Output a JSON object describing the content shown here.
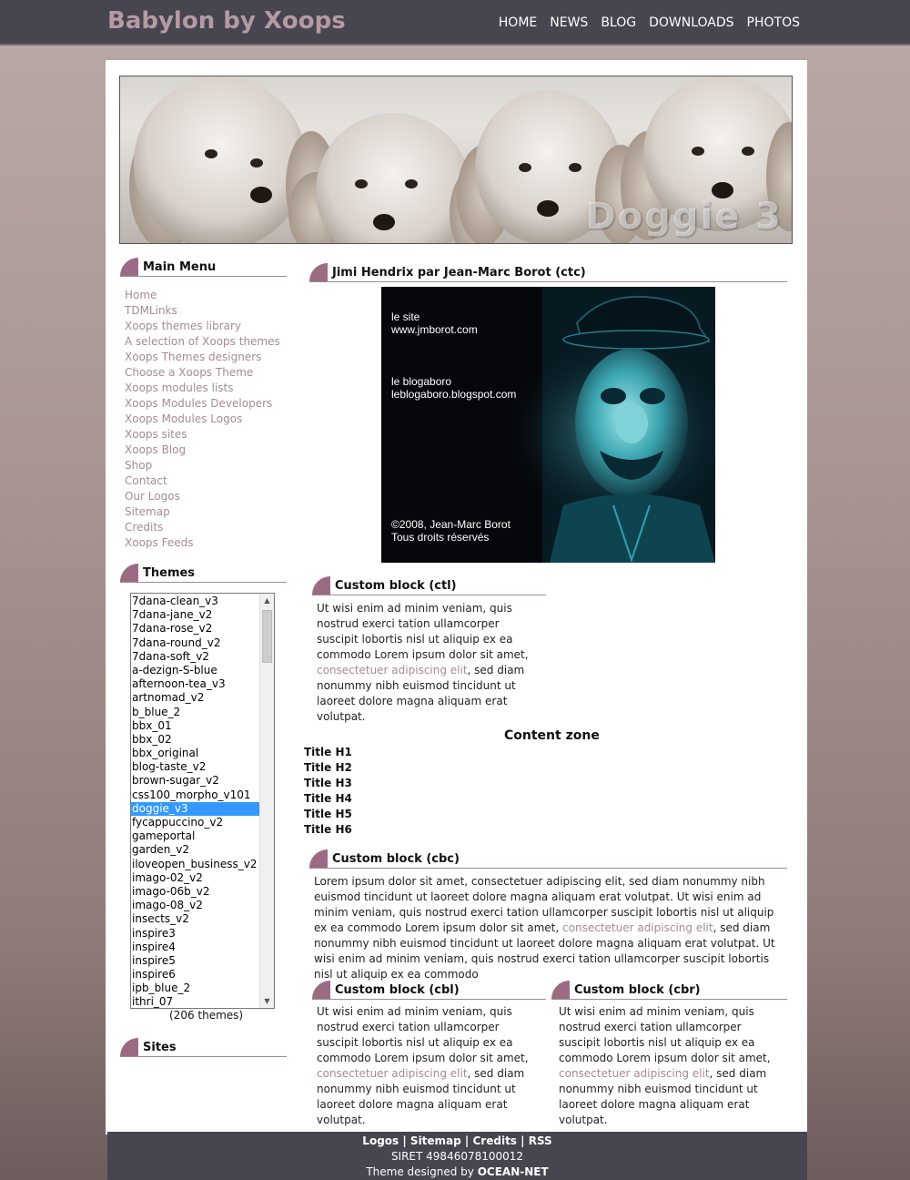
{
  "site": {
    "title": "Babylon by Xoops",
    "nav": [
      "HOME",
      "NEWS",
      "BLOG",
      "DOWNLOADS",
      "PHOTOS"
    ]
  },
  "banner": {
    "text": "Doggie 3"
  },
  "main_menu": {
    "title": "Main Menu",
    "items": [
      "Home",
      "TDMLinks",
      "Xoops themes library",
      "A selection of Xoops themes",
      "Xoops Themes designers",
      "Choose a Xoops Theme",
      "Xoops modules lists",
      "Xoops Modules Developers",
      "Xoops Modules Logos",
      "Xoops sites",
      "Xoops Blog",
      "Shop",
      "Contact",
      "Our Logos",
      "Sitemap",
      "Credits",
      "Xoops Feeds"
    ]
  },
  "themes": {
    "title": "Themes",
    "items": [
      "7dana-clean_v3",
      "7dana-jane_v2",
      "7dana-rose_v2",
      "7dana-round_v2",
      "7dana-soft_v2",
      "a-dezign-S-blue",
      "afternoon-tea_v3",
      "artnomad_v2",
      "b_blue_2",
      "bbx_01",
      "bbx_02",
      "bbx_original",
      "blog-taste_v2",
      "brown-sugar_v2",
      "css100_morpho_v101",
      "doggie_v3",
      "fycappuccino_v2",
      "gameportal",
      "garden_v2",
      "iloveopen_business_v2",
      "imago-02_v2",
      "imago-06b_v2",
      "imago-08_v2",
      "insects_v2",
      "inspire3",
      "inspire4",
      "inspire5",
      "inspire6",
      "ipb_blue_2",
      "ithri_07"
    ],
    "selected": "doggie_v3",
    "count": "(206 themes)"
  },
  "sites": {
    "title": "Sites"
  },
  "content": {
    "ctc_title": "Jimi Hendrix par Jean-Marc Borot (ctc)",
    "image_text": {
      "site_label": "le site",
      "site_url": "www.jmborot.com",
      "blog_label": "le blogaboro",
      "blog_url": "leblogaboro.blogspot.com",
      "copyright": "©2008, Jean-Marc Borot",
      "rights": "Tous droits réservés"
    },
    "ctl": {
      "title": "Custom block (ctl)",
      "text_before": "Ut wisi enim ad minim veniam, quis nostrud exerci tation ullamcorper suscipit lobortis nisl ut aliquip ex ea commodo Lorem ipsum dolor sit amet,",
      "link": "consectetuer adipiscing elit",
      "text_after": ", sed diam nonummy nibh euismod tincidunt ut laoreet dolore magna aliquam erat volutpat."
    },
    "content_zone": "Content zone",
    "headings": [
      "Title H1",
      "Title H2",
      "Title H3",
      "Title H4",
      "Title H5",
      "Title H6"
    ],
    "cbc": {
      "title": "Custom block (cbc)",
      "text_before": "Lorem ipsum dolor sit amet, consectetuer adipiscing elit, sed diam nonummy nibh euismod tincidunt ut laoreet dolore magna aliquam erat volutpat. Ut wisi enim ad minim veniam, quis nostrud exerci tation ullamcorper suscipit lobortis nisl ut aliquip ex ea commodo Lorem ipsum dolor sit amet,",
      "link": "consectetuer adipiscing elit",
      "text_after": ", sed diam nonummy nibh euismod tincidunt ut laoreet dolore magna aliquam erat volutpat. Ut wisi enim ad minim veniam, quis nostrud exerci tation ullamcorper suscipit lobortis nisl ut aliquip ex ea commodo"
    },
    "cbl": {
      "title": "Custom block (cbl)",
      "text_before": "Ut wisi enim ad minim veniam, quis nostrud exerci tation ullamcorper suscipit lobortis nisl ut aliquip ex ea commodo Lorem ipsum dolor sit amet,",
      "link": "consectetuer adipiscing elit",
      "text_after": ", sed diam nonummy nibh euismod tincidunt ut laoreet dolore magna aliquam erat volutpat."
    },
    "cbr": {
      "title": "Custom block (cbr)",
      "text_before": "Ut wisi enim ad minim veniam, quis nostrud exerci tation ullamcorper suscipit lobortis nisl ut aliquip ex ea commodo Lorem ipsum dolor sit amet,",
      "link": "consectetuer adipiscing elit",
      "text_after": ", sed diam nonummy nibh euismod tincidunt ut laoreet dolore magna aliquam erat volutpat."
    }
  },
  "footer": {
    "links": [
      "Logos",
      "Sitemap",
      "Credits",
      "RSS"
    ],
    "separator": " | ",
    "siret": "SIRET 49846078100012",
    "designer_prefix": "Theme designed by",
    "designer": "OCEAN-NET"
  },
  "colors": {
    "topbar": "#464550",
    "accent": "#9b6b85",
    "link": "#a58b92",
    "selection": "#3399ff"
  }
}
